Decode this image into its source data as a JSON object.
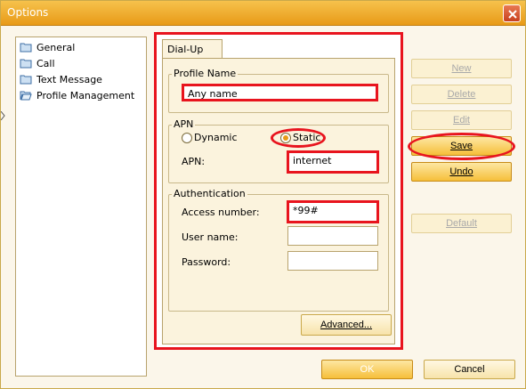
{
  "window": {
    "title": "Options"
  },
  "sidebar": {
    "items": [
      {
        "label": "General",
        "icon": "folder-icon"
      },
      {
        "label": "Call",
        "icon": "folder-icon"
      },
      {
        "label": "Text Message",
        "icon": "folder-icon"
      },
      {
        "label": "Profile Management",
        "icon": "folder-open-icon"
      }
    ]
  },
  "tab": {
    "label": "Dial-Up"
  },
  "profile_name": {
    "legend": "Profile Name",
    "value": "Any name"
  },
  "apn": {
    "legend": "APN",
    "dynamic_label": "Dynamic",
    "static_label": "Static",
    "selected": "Static",
    "field_label": "APN:",
    "value": "internet"
  },
  "authentication": {
    "legend": "Authentication",
    "access_number_label": "Access number:",
    "access_number_value": "*99#",
    "user_name_label": "User name:",
    "user_name_value": "",
    "password_label": "Password:",
    "password_value": ""
  },
  "buttons": {
    "new": "New",
    "delete": "Delete",
    "edit": "Edit",
    "save": "Save",
    "undo": "Undo",
    "default": "Default",
    "advanced": "Advanced...",
    "ok": "OK",
    "cancel": "Cancel"
  },
  "colors": {
    "highlight": "#e8141e",
    "accent": "#e89a17",
    "titlebar": "#f6c24c"
  }
}
